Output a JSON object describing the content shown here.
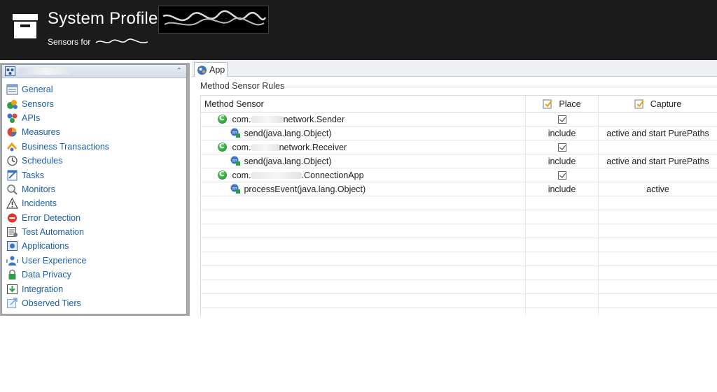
{
  "header": {
    "title": "System Profile",
    "subtitle": "Sensors for"
  },
  "nav": {
    "items": [
      {
        "label": "General",
        "icon": "general-icon"
      },
      {
        "label": "Sensors",
        "icon": "sensors-icon"
      },
      {
        "label": "APIs",
        "icon": "apis-icon"
      },
      {
        "label": "Measures",
        "icon": "measures-icon"
      },
      {
        "label": "Business Transactions",
        "icon": "business-transactions-icon"
      },
      {
        "label": "Schedules",
        "icon": "schedules-icon"
      },
      {
        "label": "Tasks",
        "icon": "tasks-icon"
      },
      {
        "label": "Monitors",
        "icon": "monitors-icon"
      },
      {
        "label": "Incidents",
        "icon": "incidents-icon"
      },
      {
        "label": "Error Detection",
        "icon": "error-detection-icon"
      },
      {
        "label": "Test Automation",
        "icon": "test-automation-icon"
      },
      {
        "label": "Applications",
        "icon": "applications-icon"
      },
      {
        "label": "User Experience",
        "icon": "user-experience-icon"
      },
      {
        "label": "Data Privacy",
        "icon": "data-privacy-icon"
      },
      {
        "label": "Integration",
        "icon": "integration-icon"
      },
      {
        "label": "Observed Tiers",
        "icon": "observed-tiers-icon"
      }
    ]
  },
  "tab": {
    "label": "App"
  },
  "section": {
    "title": "Method Sensor Rules"
  },
  "table": {
    "columns": {
      "method": "Method Sensor",
      "place": "Place",
      "capture": "Capture"
    },
    "rows": [
      {
        "kind": "class",
        "prefix": "com.",
        "suffix": "network.Sender",
        "place": "",
        "capture": ""
      },
      {
        "kind": "method",
        "name": "send(java.lang.Object)",
        "place": "include",
        "capture": "active and start PurePaths"
      },
      {
        "kind": "class",
        "prefix": "com.",
        "suffix": "network.Receiver",
        "place": "",
        "capture": ""
      },
      {
        "kind": "method",
        "name": "send(java.lang.Object)",
        "place": "include",
        "capture": "active and start PurePaths"
      },
      {
        "kind": "class",
        "prefix": "com.",
        "suffix": ".ConnectionApp",
        "place": "",
        "capture": ""
      },
      {
        "kind": "method",
        "name": "processEvent(java.lang.Object)",
        "place": "include",
        "capture": "active"
      }
    ]
  },
  "colors": {
    "header_bg": "#1b1b1b",
    "nav_link": "#1d5fa8",
    "class_icon": "#1f8c2a"
  }
}
